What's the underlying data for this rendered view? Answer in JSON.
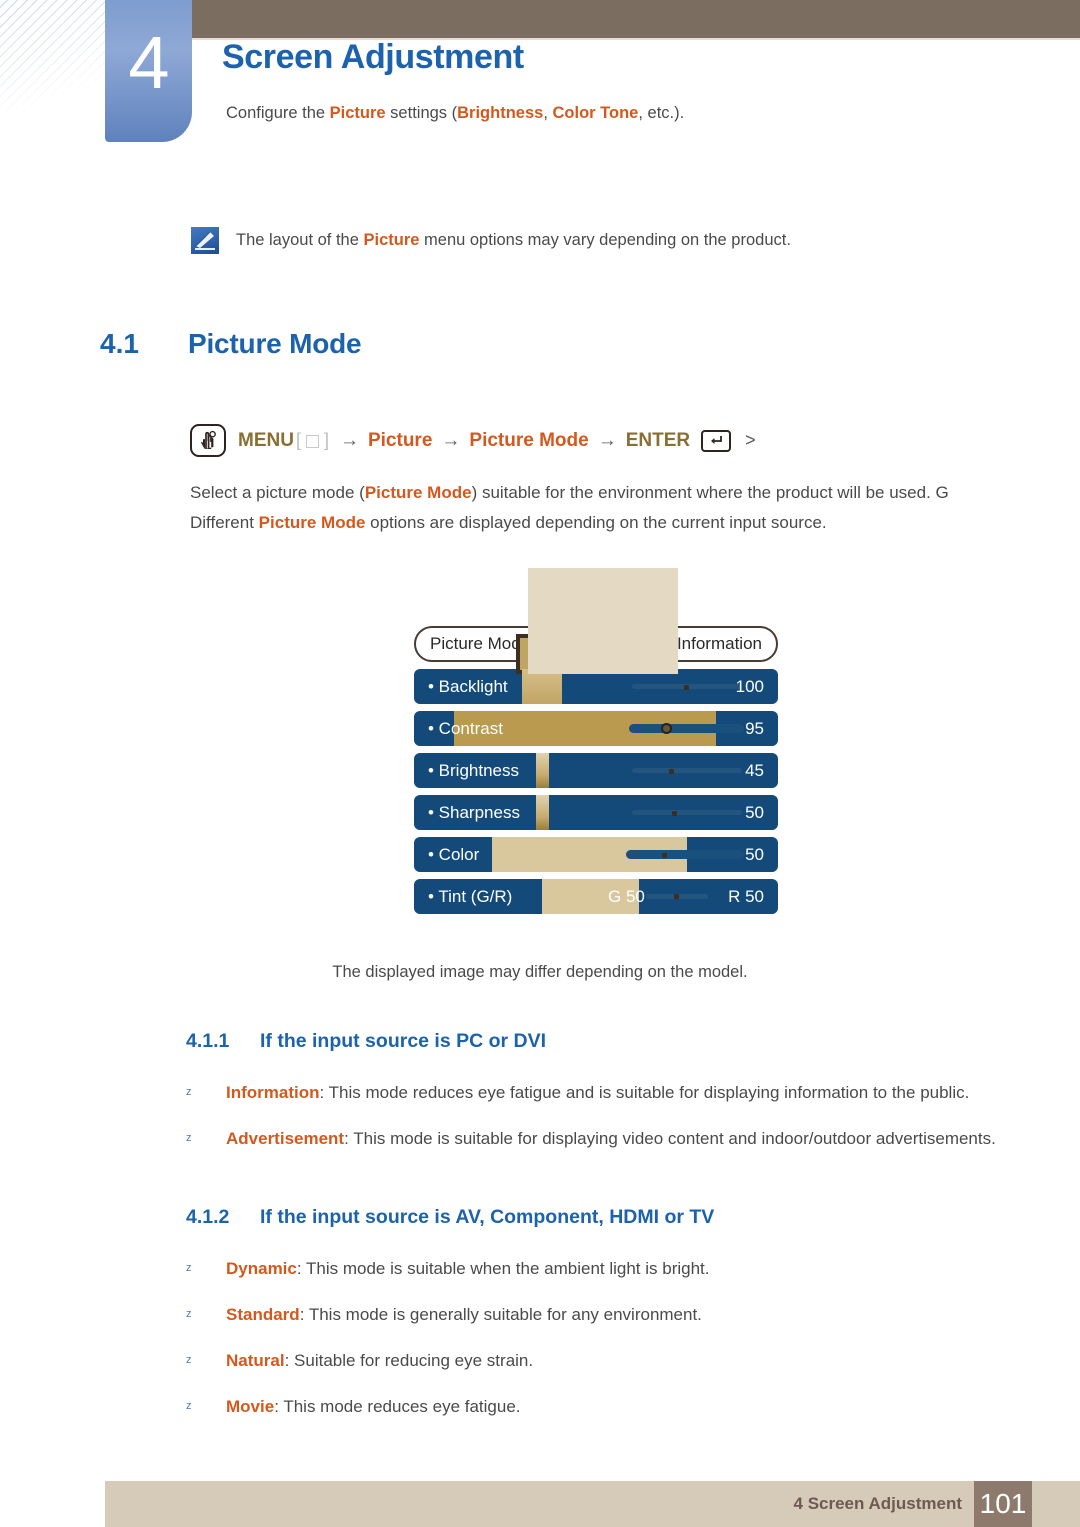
{
  "header": {
    "chapter_number": "4",
    "chapter_title": "Screen Adjustment",
    "intro_prefix": "Configure the ",
    "intro_kw1": "Picture",
    "intro_mid": " settings (",
    "intro_kw2": "Brightness",
    "intro_sep": ", ",
    "intro_kw3": "Color Tone",
    "intro_suffix": ", etc.)."
  },
  "note": {
    "icon": "note-pen-icon",
    "text_before": "The layout of the ",
    "keyword": "Picture",
    "text_after": " menu options may vary depending on the product."
  },
  "section": {
    "number": "4.1",
    "title": "Picture Mode"
  },
  "menupath": {
    "hand_icon": "hand-press-icon",
    "menu_label": "MENU",
    "bracket_open": "[",
    "square_icon": "square-button-icon",
    "bracket_close": "]",
    "arrow": "→",
    "step_picture": "Picture",
    "step_picture_mode": "Picture Mode",
    "enter_label": "ENTER",
    "enter_icon": "enter-key-icon",
    "enter_glyph": "↵",
    "trailing": ">"
  },
  "paragraph": {
    "line1_a": "Select a picture mode (",
    "line1_kw": "Picture Mode",
    "line1_b": ") suitable for the environment where the product will be used. G",
    "line2_a": "Different ",
    "line2_kw": "Picture Mode",
    "line2_b": " options are displayed depending on the current input source."
  },
  "osd": {
    "title_left": "Picture Mode",
    "title_right": "Information",
    "rows": [
      {
        "label": "• Backlight",
        "value": "100"
      },
      {
        "label": "• Contrast",
        "value": "95"
      },
      {
        "label": "• Brightness",
        "value": "45"
      },
      {
        "label": "• Sharpness",
        "value": "50"
      },
      {
        "label": "• Color",
        "value": "50"
      }
    ],
    "tint": {
      "label": "• Tint (G/R)",
      "green": "G 50",
      "red": "R 50"
    },
    "colors": {
      "row_bg": "#134a79",
      "fill": "#b99a4f",
      "overlay": "#e4d9c2"
    }
  },
  "caption": "The displayed image may differ depending on the model.",
  "subsection_1": {
    "number": "4.1.1",
    "title": "If the input source is PC or DVI",
    "bullets": [
      {
        "mark": "z",
        "keyword": "Information",
        "text": ": This mode reduces eye fatigue and is suitable for displaying information to the public."
      },
      {
        "mark": "z",
        "keyword": "Advertisement",
        "text": ": This mode is suitable for displaying video content and indoor/outdoor advertisements."
      }
    ]
  },
  "subsection_2": {
    "number": "4.1.2",
    "title": "If the input source is AV, Component, HDMI or TV",
    "bullets": [
      {
        "mark": "z",
        "keyword": "Dynamic",
        "text": ": This mode is suitable when the ambient light is bright."
      },
      {
        "mark": "z",
        "keyword": "Standard",
        "text": ": This mode is generally suitable for any environment."
      },
      {
        "mark": "z",
        "keyword": "Natural",
        "text": ": Suitable for reducing eye strain."
      },
      {
        "mark": "z",
        "keyword": "Movie",
        "text": ": This mode reduces eye fatigue."
      }
    ]
  },
  "footer": {
    "text": "4 Screen Adjustment",
    "page": "101"
  },
  "theme": {
    "heading_blue": "#1c62ad",
    "keyword_orange": "#d4591e",
    "header_brown": "#7b6d60",
    "footer_tan": "#d6cab9",
    "tab_blue": "#7e9cce"
  }
}
